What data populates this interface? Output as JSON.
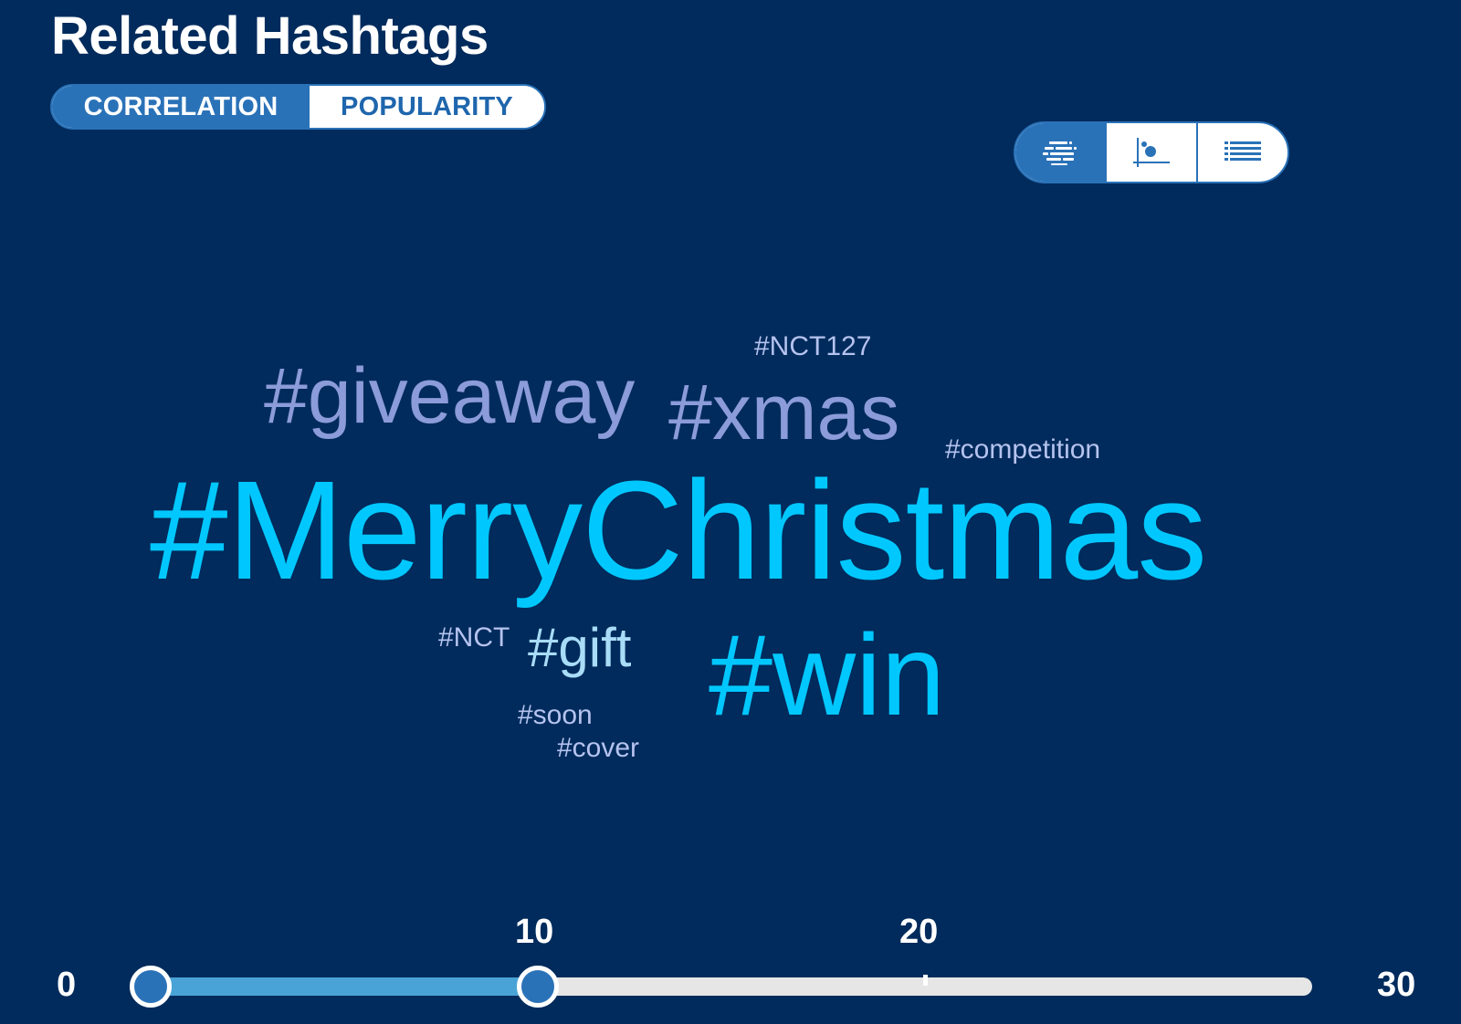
{
  "header": {
    "title": "Related Hashtags"
  },
  "sort_toggle": {
    "options": [
      {
        "label": "CORRELATION",
        "active": true
      },
      {
        "label": "POPULARITY",
        "active": false
      }
    ]
  },
  "view_toggle": {
    "options": [
      {
        "icon": "word-cloud-icon",
        "active": true
      },
      {
        "icon": "scatter-plot-icon",
        "active": false
      },
      {
        "icon": "list-icon",
        "active": false
      }
    ]
  },
  "colors": {
    "background": "#002b5c",
    "accent": "#2a72b8",
    "cyan": "#00c8ff",
    "lavender": "#8c9bd9",
    "light_lavender": "#b6c3ef"
  },
  "word_cloud": {
    "words": [
      {
        "text": "#MerryChristmas",
        "color": "#00c8ff"
      },
      {
        "text": "#win",
        "color": "#00c8ff"
      },
      {
        "text": "#giveaway",
        "color": "#8c9bd9"
      },
      {
        "text": "#xmas",
        "color": "#8c9bd9"
      },
      {
        "text": "#gift",
        "color": "#a9dcf7"
      },
      {
        "text": "#NCT127",
        "color": "#b6c3ef"
      },
      {
        "text": "#competition",
        "color": "#b6c3ef"
      },
      {
        "text": "#NCT",
        "color": "#b6c3ef"
      },
      {
        "text": "#soon",
        "color": "#b6c3ef"
      },
      {
        "text": "#cover",
        "color": "#b6c3ef"
      }
    ]
  },
  "range_slider": {
    "min": 0,
    "max": 30,
    "min_label": "0",
    "max_label": "30",
    "tick_labels": [
      "10",
      "20"
    ],
    "selected_low": 0,
    "selected_high": 10
  }
}
